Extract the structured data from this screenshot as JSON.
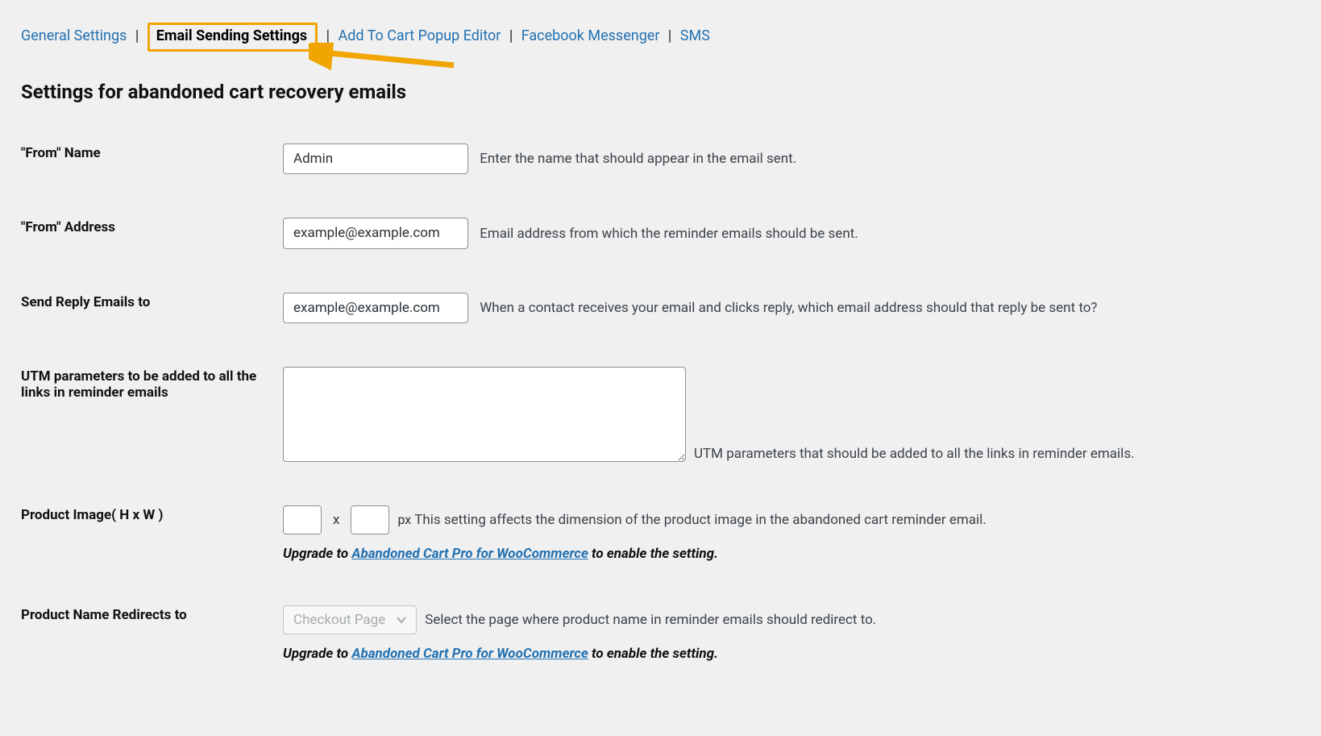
{
  "tabs": {
    "general": "General Settings",
    "email": "Email Sending Settings",
    "addtocart": "Add To Cart Popup Editor",
    "facebook": "Facebook Messenger",
    "sms": "SMS"
  },
  "page_title": "Settings for abandoned cart recovery emails",
  "fields": {
    "from_name": {
      "label": "\"From\" Name",
      "value": "Admin",
      "help": "Enter the name that should appear in the email sent."
    },
    "from_address": {
      "label": "\"From\" Address",
      "value": "example@example.com",
      "help": "Email address from which the reminder emails should be sent."
    },
    "reply_to": {
      "label": "Send Reply Emails to",
      "value": "example@example.com",
      "help": "When a contact receives your email and clicks reply, which email address should that reply be sent to?"
    },
    "utm": {
      "label": "UTM parameters to be added to all the links in reminder emails",
      "value": "",
      "help": "UTM parameters that should be added to all the links in reminder emails."
    },
    "product_image": {
      "label": "Product Image( H x W )",
      "height": "",
      "width": "",
      "sep": "x",
      "px": "px",
      "help": "This setting affects the dimension of the product image in the abandoned cart reminder email."
    },
    "redirect": {
      "label": "Product Name Redirects to",
      "value": "Checkout Page",
      "help": "Select the page where product name in reminder emails should redirect to."
    }
  },
  "upgrade": {
    "pre": "Upgrade to ",
    "link": "Abandoned Cart Pro for WooCommerce",
    "post": " to enable the setting."
  }
}
